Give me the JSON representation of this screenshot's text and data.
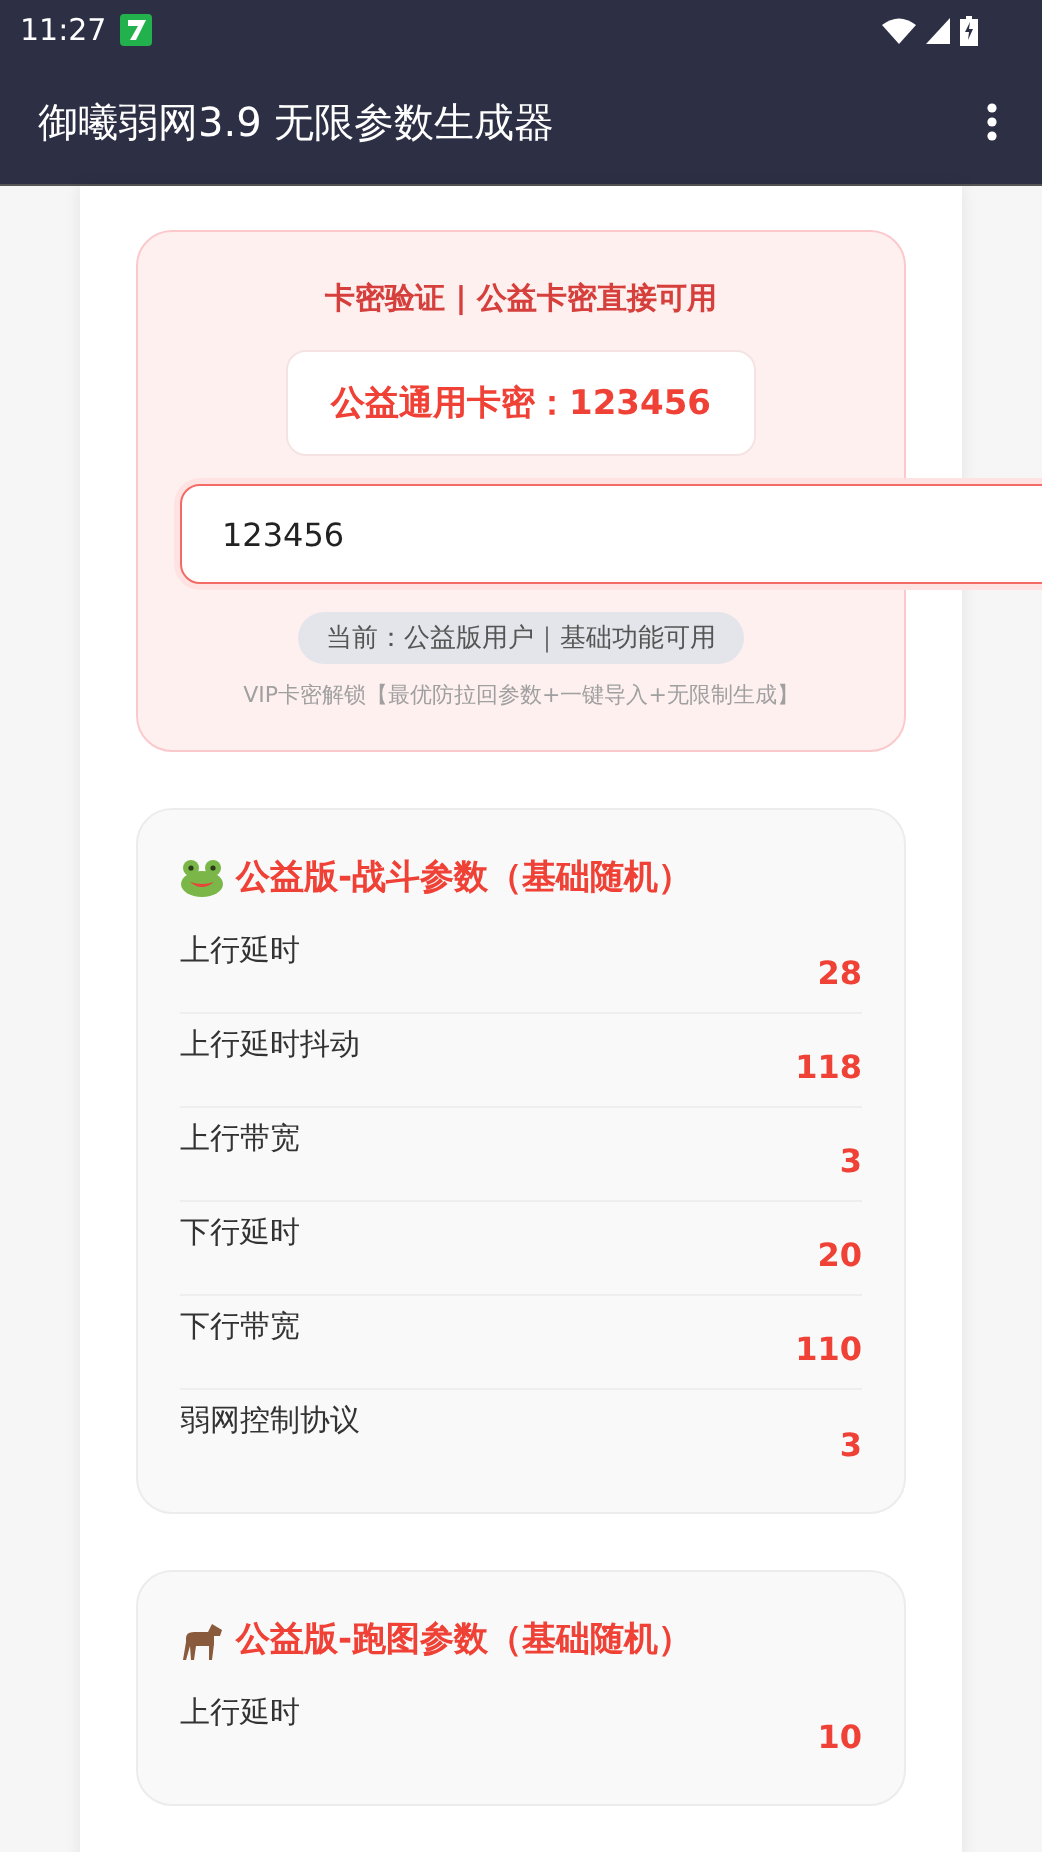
{
  "status_bar": {
    "time": "11:27"
  },
  "app_bar": {
    "title": "御曦弱网3.9 无限参数生成器"
  },
  "verify_card": {
    "title": "卡密验证 | 公益卡密直接可用",
    "public_key": "公益通用卡密：123456",
    "input": {
      "value": "123456"
    },
    "status_pill": "当前：公益版用户｜基础功能可用",
    "vip_note": "VIP卡密解锁【最优防拉回参数+一键导入+无限制生成】"
  },
  "sections": [
    {
      "title": "公益版-战斗参数（基础随机）",
      "rows": [
        {
          "label": "上行延时",
          "value": "28"
        },
        {
          "label": "上行延时抖动",
          "value": "118"
        },
        {
          "label": "上行带宽",
          "value": "3"
        },
        {
          "label": "下行延时",
          "value": "20"
        },
        {
          "label": "下行带宽",
          "value": "110"
        },
        {
          "label": "弱网控制协议",
          "value": "3"
        }
      ]
    },
    {
      "title": "公益版-跑图参数（基础随机）",
      "rows": [
        {
          "label": "上行延时",
          "value": "10"
        }
      ]
    }
  ]
}
